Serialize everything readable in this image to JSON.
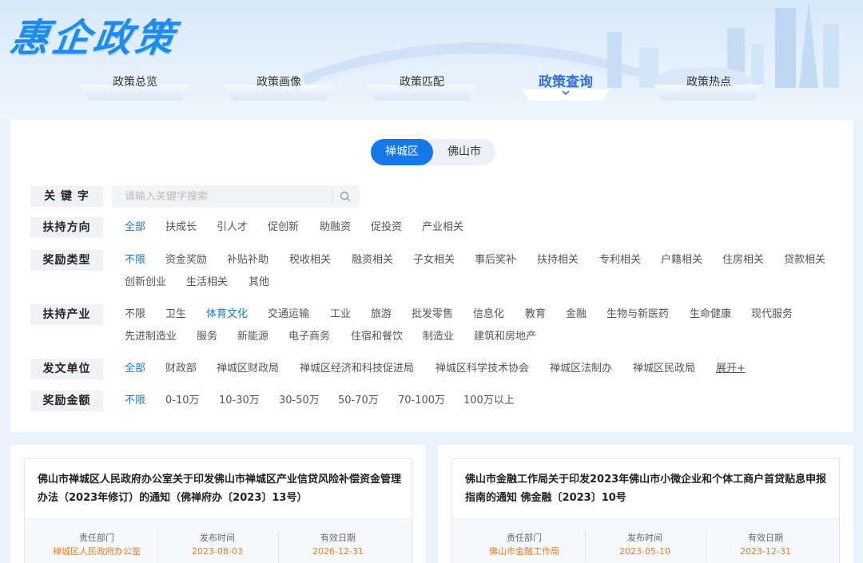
{
  "brand": {
    "title": "惠企政策"
  },
  "nav": [
    {
      "label": "政策总览"
    },
    {
      "label": "政策画像"
    },
    {
      "label": "政策匹配"
    },
    {
      "label": "政策查询",
      "active": true
    },
    {
      "label": "政策热点"
    }
  ],
  "region": {
    "options": [
      "禅城区",
      "佛山市"
    ],
    "selected": "禅城区"
  },
  "filters": {
    "keyword": {
      "label": "关 键 字",
      "placeholder": "请输入关键字搜索"
    },
    "direction": {
      "label": "扶持方向",
      "options": [
        "全部",
        "扶成长",
        "引人才",
        "促创新",
        "助融资",
        "促投资",
        "产业相关"
      ],
      "selected": "全部"
    },
    "reward_type": {
      "label": "奖励类型",
      "options": [
        "不限",
        "资金奖励",
        "补贴补助",
        "税收相关",
        "融资相关",
        "子女相关",
        "事后奖补",
        "扶持相关",
        "专利相关",
        "户籍相关",
        "住房相关",
        "贷款相关",
        "创新创业",
        "生活相关",
        "其他"
      ],
      "selected": "不限"
    },
    "industry": {
      "label": "扶持产业",
      "options": [
        "不限",
        "卫生",
        "体育文化",
        "交通运输",
        "工业",
        "旅游",
        "批发零售",
        "信息化",
        "教育",
        "金融",
        "生物与新医药",
        "生命健康",
        "现代服务",
        "先进制造业",
        "服务",
        "新能源",
        "电子商务",
        "住宿和餐饮",
        "制造业",
        "建筑和房地产"
      ],
      "selected": "体育文化"
    },
    "issuer": {
      "label": "发文单位",
      "options": [
        "全部",
        "财政部",
        "禅城区财政局",
        "禅城区经济和科技促进局",
        "禅城区科学技术协会",
        "禅城区法制办",
        "禅城区民政局"
      ],
      "selected": "全部",
      "more_label": "展开+"
    },
    "amount": {
      "label": "奖励金额",
      "options": [
        "不限",
        "0-10万",
        "10-30万",
        "30-50万",
        "50-70万",
        "70-100万",
        "100万以上"
      ],
      "selected": "不限"
    }
  },
  "meta_labels": {
    "dept": "责任部门",
    "publish": "发布时间",
    "valid": "有效日期"
  },
  "policies": [
    {
      "title": "佛山市禅城区人民政府办公室关于印发佛山市禅城区产业信贷风险补偿资金管理办法（2023年修订）的通知（佛禅府办〔2023〕13号）",
      "dept": "禅城区人民政府办公室",
      "publish": "2023-08-03",
      "valid": "2026-12-31"
    },
    {
      "title": "佛山市金融工作局关于印发2023年佛山市小微企业和个体工商户首贷贴息申报指南的通知 佛金融〔2023〕10号",
      "dept": "佛山市金融工作局",
      "publish": "2023-05-10",
      "valid": "2023-12-31"
    }
  ],
  "colors": {
    "accent": "#1677e8",
    "highlight": "#f07b1d",
    "brand": "#1e8bf0"
  }
}
